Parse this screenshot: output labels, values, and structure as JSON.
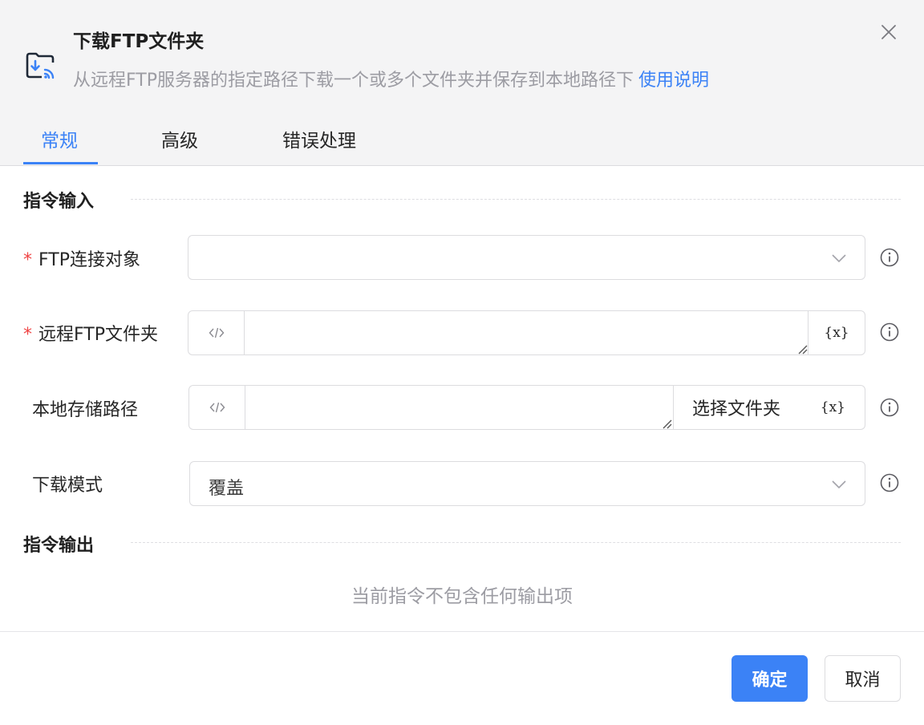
{
  "dialog": {
    "title": "下载FTP文件夹",
    "description": "从远程FTP服务器的指定路径下载一个或多个文件夹并保存到本地路径下",
    "help_link": "使用说明",
    "icon": "folder-download-icon",
    "close_icon": "close-icon"
  },
  "tabs": [
    {
      "label": "常规",
      "active": true
    },
    {
      "label": "高级",
      "active": false
    },
    {
      "label": "错误处理",
      "active": false
    }
  ],
  "input_section": {
    "title": "指令输入",
    "fields": [
      {
        "label": "FTP连接对象",
        "required": true,
        "type": "select",
        "value": ""
      },
      {
        "label": "远程FTP文件夹",
        "required": true,
        "type": "code-text",
        "value": "",
        "variable_button": "{x}"
      },
      {
        "label": "本地存储路径",
        "required": false,
        "type": "code-text",
        "value": "",
        "choose_button": "选择文件夹",
        "variable_button": "{x}"
      },
      {
        "label": "下载模式",
        "required": false,
        "type": "select",
        "value": "覆盖"
      }
    ]
  },
  "output_section": {
    "title": "指令输出",
    "empty_text": "当前指令不包含任何输出项"
  },
  "footer": {
    "confirm": "确定",
    "cancel": "取消"
  },
  "colors": {
    "accent": "#3b82f6",
    "required": "#ef4444",
    "header_bg": "#f4f4f5"
  }
}
